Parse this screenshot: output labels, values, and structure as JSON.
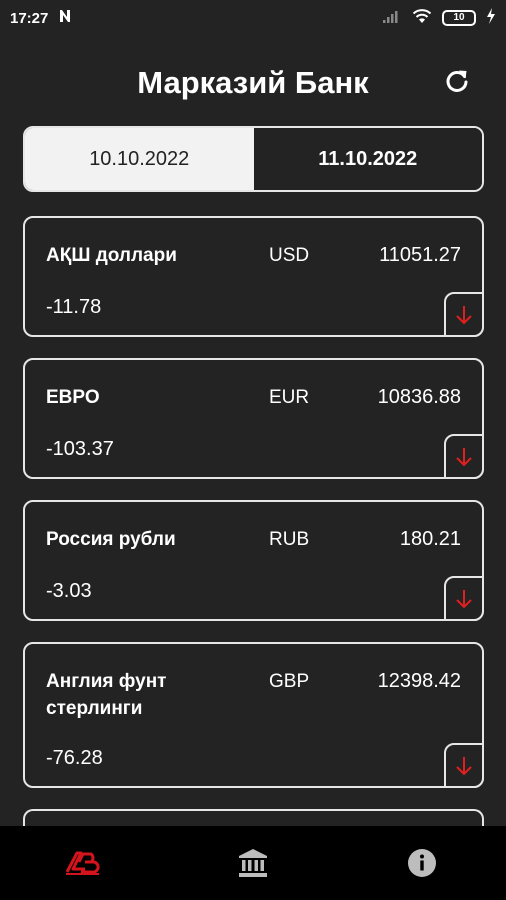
{
  "status_bar": {
    "time": "17:27",
    "battery": "10"
  },
  "header": {
    "title": "Марказий Банк"
  },
  "date_tabs": [
    {
      "label": "10.10.2022",
      "active": true
    },
    {
      "label": "11.10.2022",
      "active": false
    }
  ],
  "currencies": [
    {
      "name": "АҚШ доллари",
      "code": "USD",
      "rate": "11051.27",
      "diff": "-11.78",
      "trend": "down"
    },
    {
      "name": "ЕВРО",
      "code": "EUR",
      "rate": "10836.88",
      "diff": "-103.37",
      "trend": "down"
    },
    {
      "name": "Россия рубли",
      "code": "RUB",
      "rate": "180.21",
      "diff": "-3.03",
      "trend": "down"
    },
    {
      "name": "Англия фунт стерлинги",
      "code": "GBP",
      "rate": "12398.42",
      "diff": "-76.28",
      "trend": "down"
    }
  ],
  "bottom_nav": [
    {
      "icon": "app-logo-icon",
      "active": true
    },
    {
      "icon": "bank-icon",
      "active": false
    },
    {
      "icon": "info-icon",
      "active": false
    }
  ],
  "colors": {
    "background": "#232323",
    "border": "#e6e6e6",
    "trend_down": "#e02020",
    "nav_background": "#000000",
    "accent": "#d4141c"
  }
}
